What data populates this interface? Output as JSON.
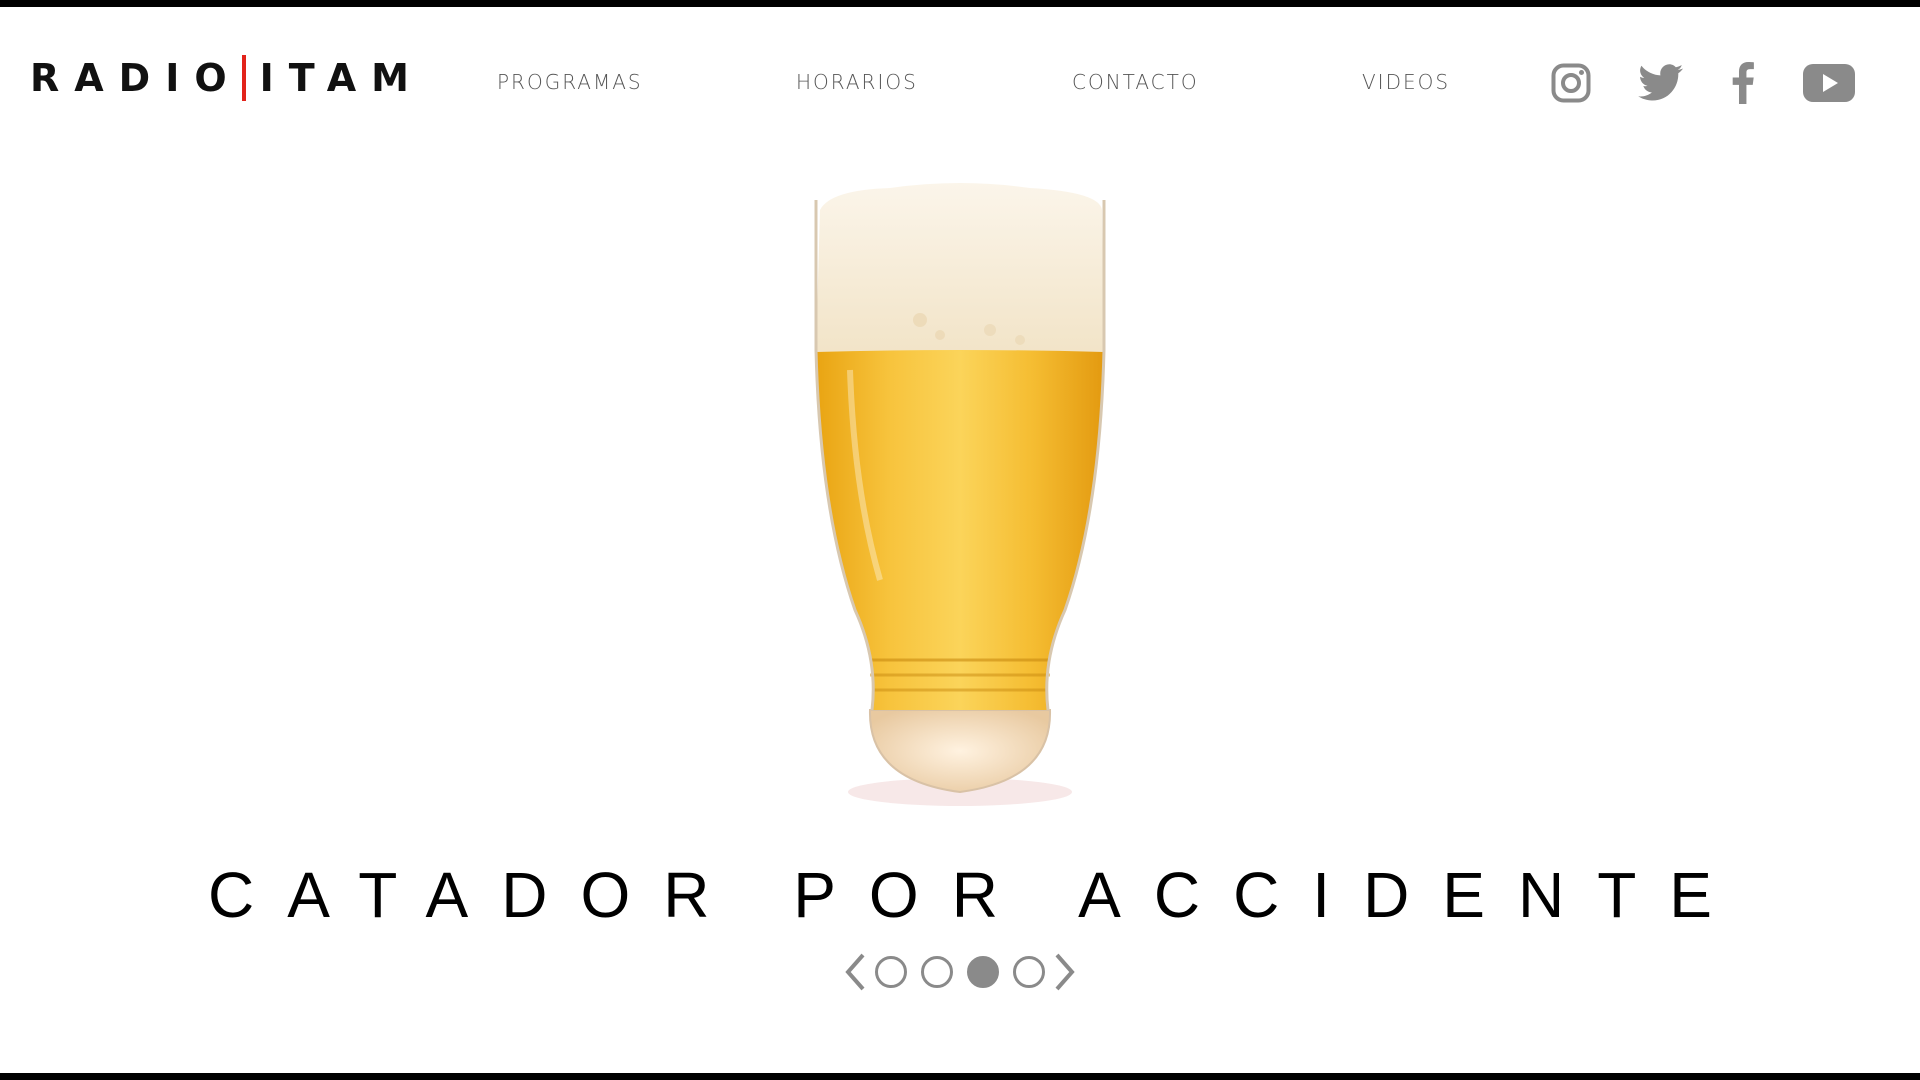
{
  "header": {
    "logo": {
      "left_text": "RADIO",
      "right_text": "ITAM",
      "accent_color": "#e2231a"
    },
    "nav": [
      {
        "label": "PROGRAMAS"
      },
      {
        "label": "HORARIOS"
      },
      {
        "label": "CONTACTO"
      },
      {
        "label": "VIDEOS"
      }
    ],
    "social": [
      {
        "icon": "instagram-icon"
      },
      {
        "icon": "twitter-icon"
      },
      {
        "icon": "facebook-icon"
      },
      {
        "icon": "youtube-icon"
      }
    ],
    "icon_color": "#8a8a8a"
  },
  "hero": {
    "image": "beer-glass",
    "headline": "CATADOR POR ACCIDENTE"
  },
  "slider": {
    "slide_count": 4,
    "active_index": 2,
    "control_color": "#8a8a8a"
  }
}
